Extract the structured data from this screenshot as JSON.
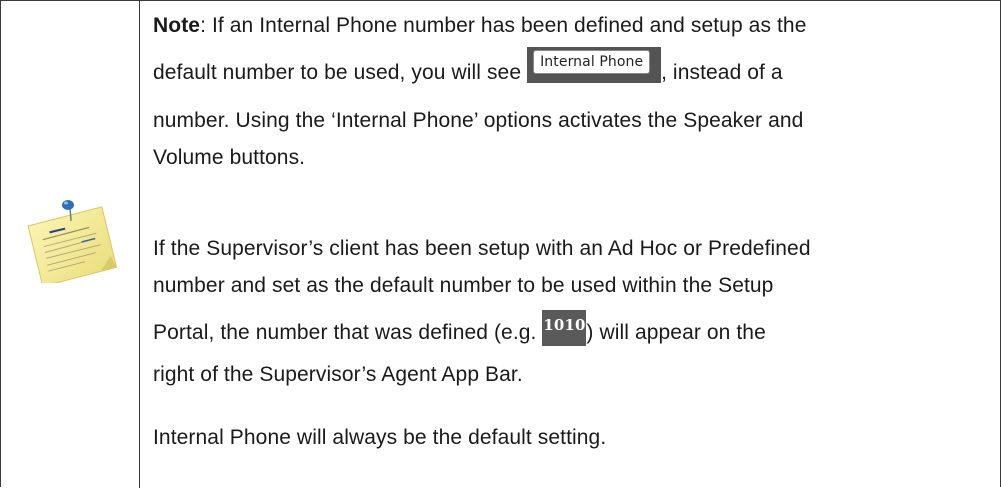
{
  "note": {
    "label": "Note",
    "p1_line1_rest": ": If an Internal Phone number has been defined and setup as the",
    "p1_line2_before": "default number to be used, you will see ",
    "internal_phone_button_label": "Internal Phone",
    "p1_line2_after": ", instead of a",
    "p1_line3": "number. Using the ‘Internal Phone’ options activates the Speaker and",
    "p1_line4": "Volume buttons.",
    "p2_line1": "If the Supervisor’s client has been setup with an Ad Hoc or Predefined",
    "p2_line2": "number and set as the default number to be used within the Setup",
    "p2_line3_before": "Portal, the number that was defined (e.g. ",
    "example_number": "1010",
    "p2_line3_after": ") will appear on the",
    "p2_line4": "right of the Supervisor’s Agent App Bar.",
    "p3_line1": "Internal Phone will always be the default setting."
  },
  "icon": "sticky-note-icon",
  "colors": {
    "border": "#3a3a3a",
    "button_bg": "#545454",
    "badge_bg": "#5a5a5a",
    "note_yellow": "#f4ec9a",
    "pin_blue": "#2f6fb5"
  }
}
